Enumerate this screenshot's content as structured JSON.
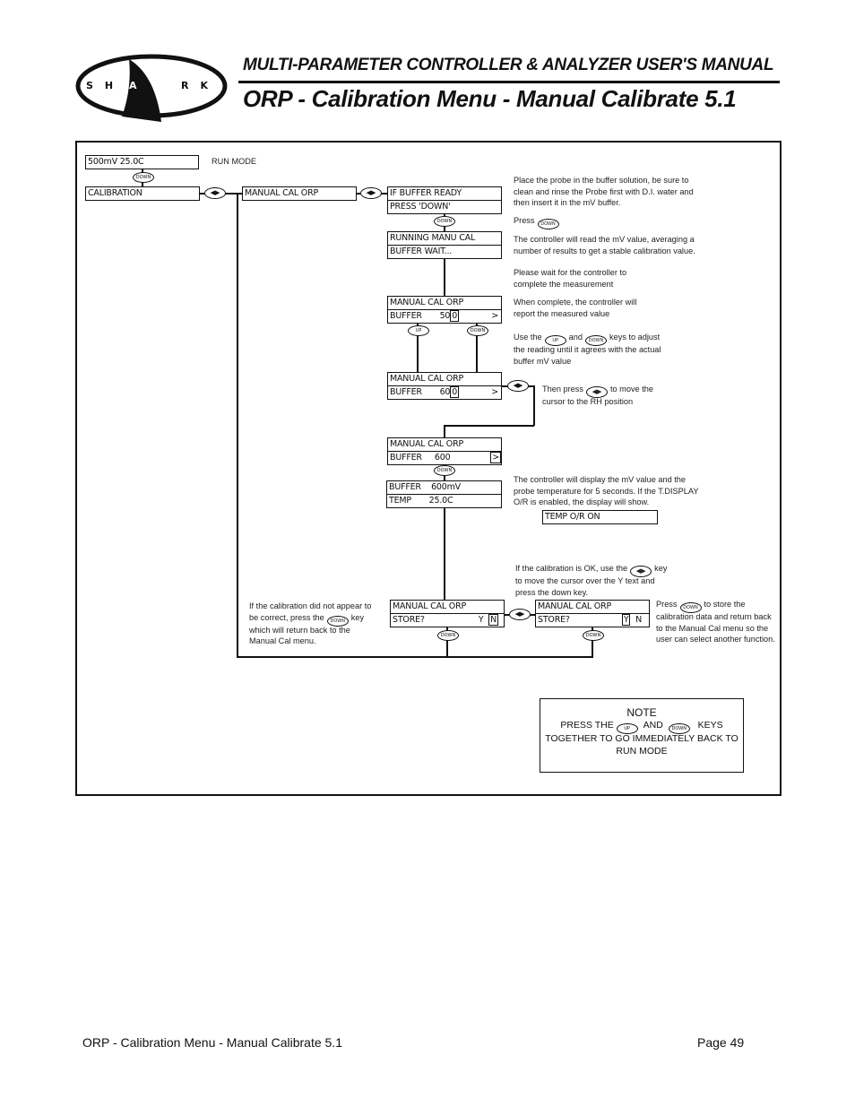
{
  "header": {
    "logo_text": "S H A R K",
    "manual_title": "MULTI-PARAMETER CONTROLLER & ANALYZER USER'S MANUAL",
    "page_title": "ORP - Calibration Menu - Manual Calibrate 5.1"
  },
  "keys": {
    "down": "DOWN",
    "up": "UP",
    "lr": "◀▶"
  },
  "diagram": {
    "run_display": "500mV   25.0C",
    "run_mode_label": "RUN MODE",
    "calibration": "CALIBRATION",
    "manual_cal_orp": "MANUAL CAL ORP",
    "buffer_ready": {
      "line1": "IF BUFFER READY",
      "line2": "PRESS 'DOWN'"
    },
    "running": {
      "line1": "RUNNING MANU CAL",
      "line2": "BUFFER  WAIT..."
    },
    "adjust1": {
      "line1": "MANUAL CAL ORP",
      "line2_label": "BUFFER",
      "line2_value": "50",
      "cursor": "0",
      "arrow": ">"
    },
    "adjust2": {
      "line1": "MANUAL CAL ORP",
      "line2_label": "BUFFER",
      "line2_value": "60",
      "cursor": "0",
      "arrow": ">"
    },
    "adjust3": {
      "line1": "MANUAL CAL ORP",
      "line2_label": "BUFFER",
      "line2_value": "600",
      "arrow": ">"
    },
    "result": {
      "line1": "BUFFER    600mV",
      "line2": "TEMP       25.0C"
    },
    "temp_or": "TEMP O/R ON",
    "store_n": {
      "line1": "MANUAL CAL ORP",
      "label": "STORE?",
      "y": "Y",
      "n": "N"
    },
    "store_y": {
      "line1": "MANUAL CAL ORP",
      "label": "STORE?",
      "y": "Y",
      "n": "N"
    }
  },
  "notes": {
    "place_probe": "Place the probe in the buffer solution, be sure to clean and rinse the Probe first with D.I. water and then insert it in the mV buffer.",
    "press": "Press",
    "controller_read": "The controller will read the mV value, averaging a number of results to get a stable calibration value.",
    "please_wait": "Please wait for the controller to complete the measurement",
    "when_complete": "When complete, the controller will report the measured value",
    "use_the": "Use the",
    "and": "and",
    "keys_to": "keys to adjust the reading until it agrees with the actual buffer mV value",
    "then_press": "Then press",
    "to_move": "to move the cursor to the RH position",
    "display_mv": "The controller will display the mV value and the probe temperature for 5 seconds. If the T.DISPLAY O/R is enabled, the display will show.",
    "if_ok_a": "If the calibration is OK, use the",
    "if_ok_b": "key to move the cursor over the Y text and press the down key.",
    "not_correct_a": "If the calibration did not appear to be correct, press the",
    "not_correct_b": "key which will return back to the Manual Cal menu.",
    "store_a": "Press",
    "store_b": "to store the calibration data and return back to the Manual Cal menu so the user can select another function."
  },
  "note_box": {
    "title": "NOTE",
    "press_the": "PRESS THE",
    "and": "AND",
    "keys": "KEYS",
    "line2": "TOGETHER TO GO IMMEDIATELY BACK TO",
    "line3": "RUN MODE"
  },
  "footer": {
    "section": "ORP - Calibration Menu - Manual Calibrate 5.1",
    "page": "Page 49"
  }
}
